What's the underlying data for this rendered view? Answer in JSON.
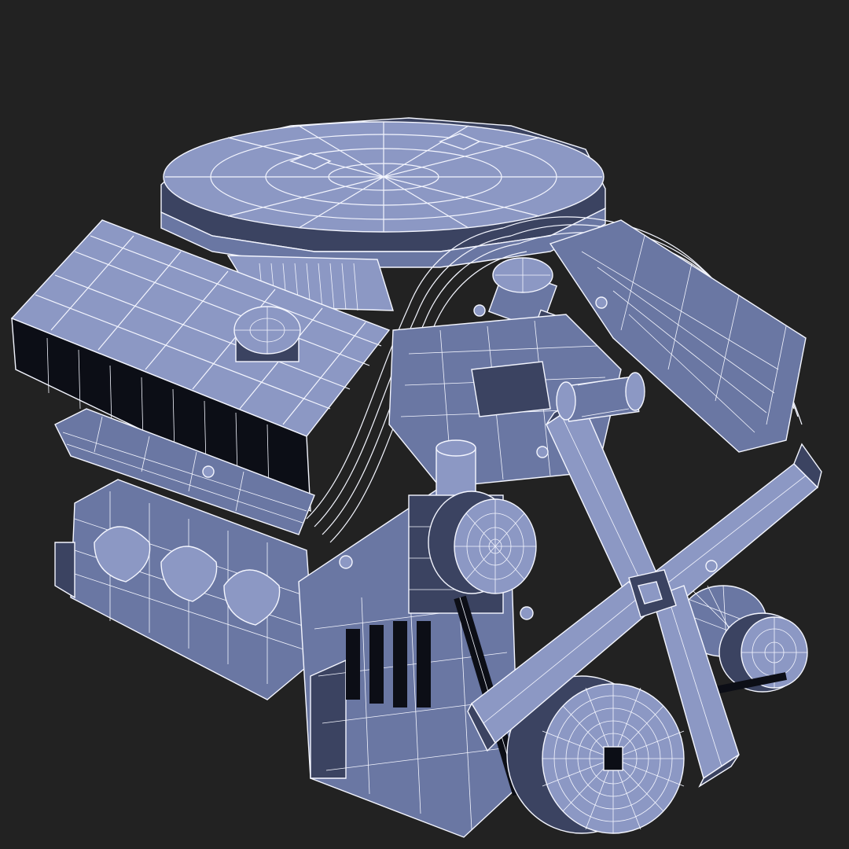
{
  "viewport": {
    "background_color": "#222222",
    "wire_color": "#f4f6ff",
    "surface_colors": {
      "light": "#8c98c4",
      "mid": "#6a77a3",
      "dark": "#3b4361",
      "shadow": "#0c0e16"
    }
  }
}
